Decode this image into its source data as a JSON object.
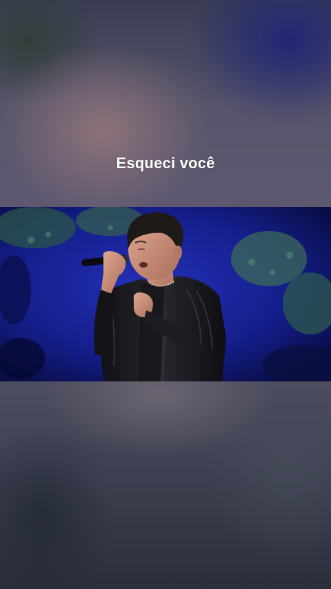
{
  "story": {
    "caption": "Esqueci você"
  },
  "video": {
    "subject": "singer-with-microphone",
    "colors": {
      "stage_blue": "#14209a",
      "foliage": "#3b6a5a",
      "jacket": "#1a1a1f",
      "skin": "#c8927a"
    }
  }
}
